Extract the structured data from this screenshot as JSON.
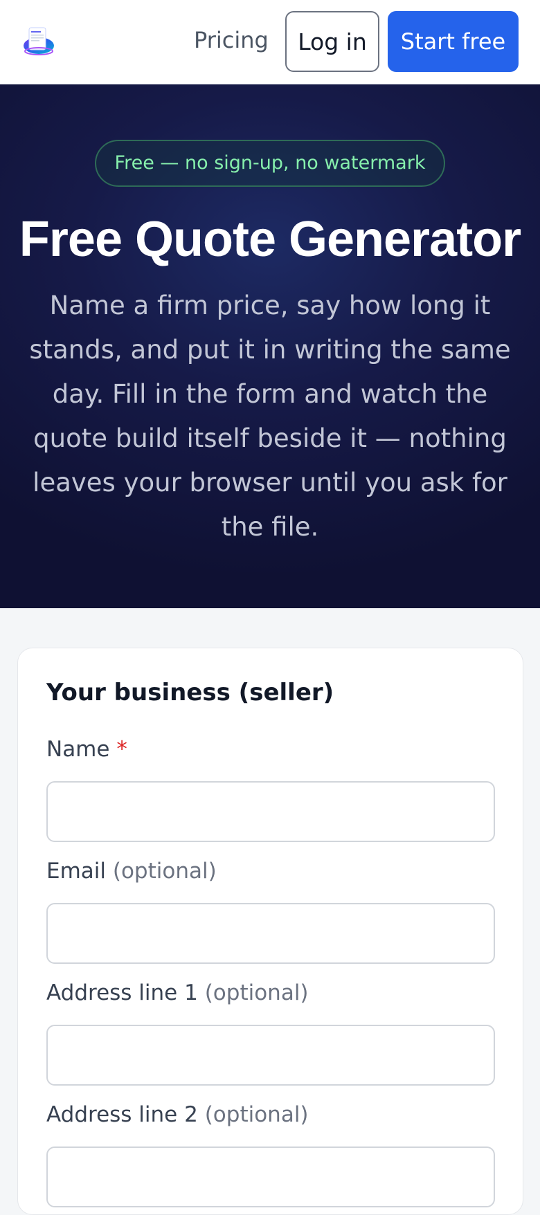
{
  "header": {
    "logo_icon": "invoice-document-logo",
    "nav_pricing": "Pricing",
    "login_label": "Log in",
    "start_label": "Start free",
    "colors": {
      "primary": "#2563eb"
    }
  },
  "hero": {
    "badge": "Free — no sign-up, no watermark",
    "title": "Free Quote Generator",
    "subtitle": "Name a firm price, say how long it stands, and put it in writing the same day. Fill in the form and watch the quote build itself beside it — nothing leaves your browser until you ask for the file."
  },
  "form": {
    "section_title": "Your business (seller)",
    "fields": [
      {
        "label": "Name",
        "required_mark": "*",
        "optional": "",
        "value": "",
        "placeholder": ""
      },
      {
        "label": "Email",
        "required_mark": "",
        "optional": "(optional)",
        "value": "",
        "placeholder": ""
      },
      {
        "label": "Address line 1",
        "required_mark": "",
        "optional": "(optional)",
        "value": "",
        "placeholder": ""
      },
      {
        "label": "Address line 2",
        "required_mark": "",
        "optional": "(optional)",
        "value": "",
        "placeholder": ""
      }
    ]
  }
}
